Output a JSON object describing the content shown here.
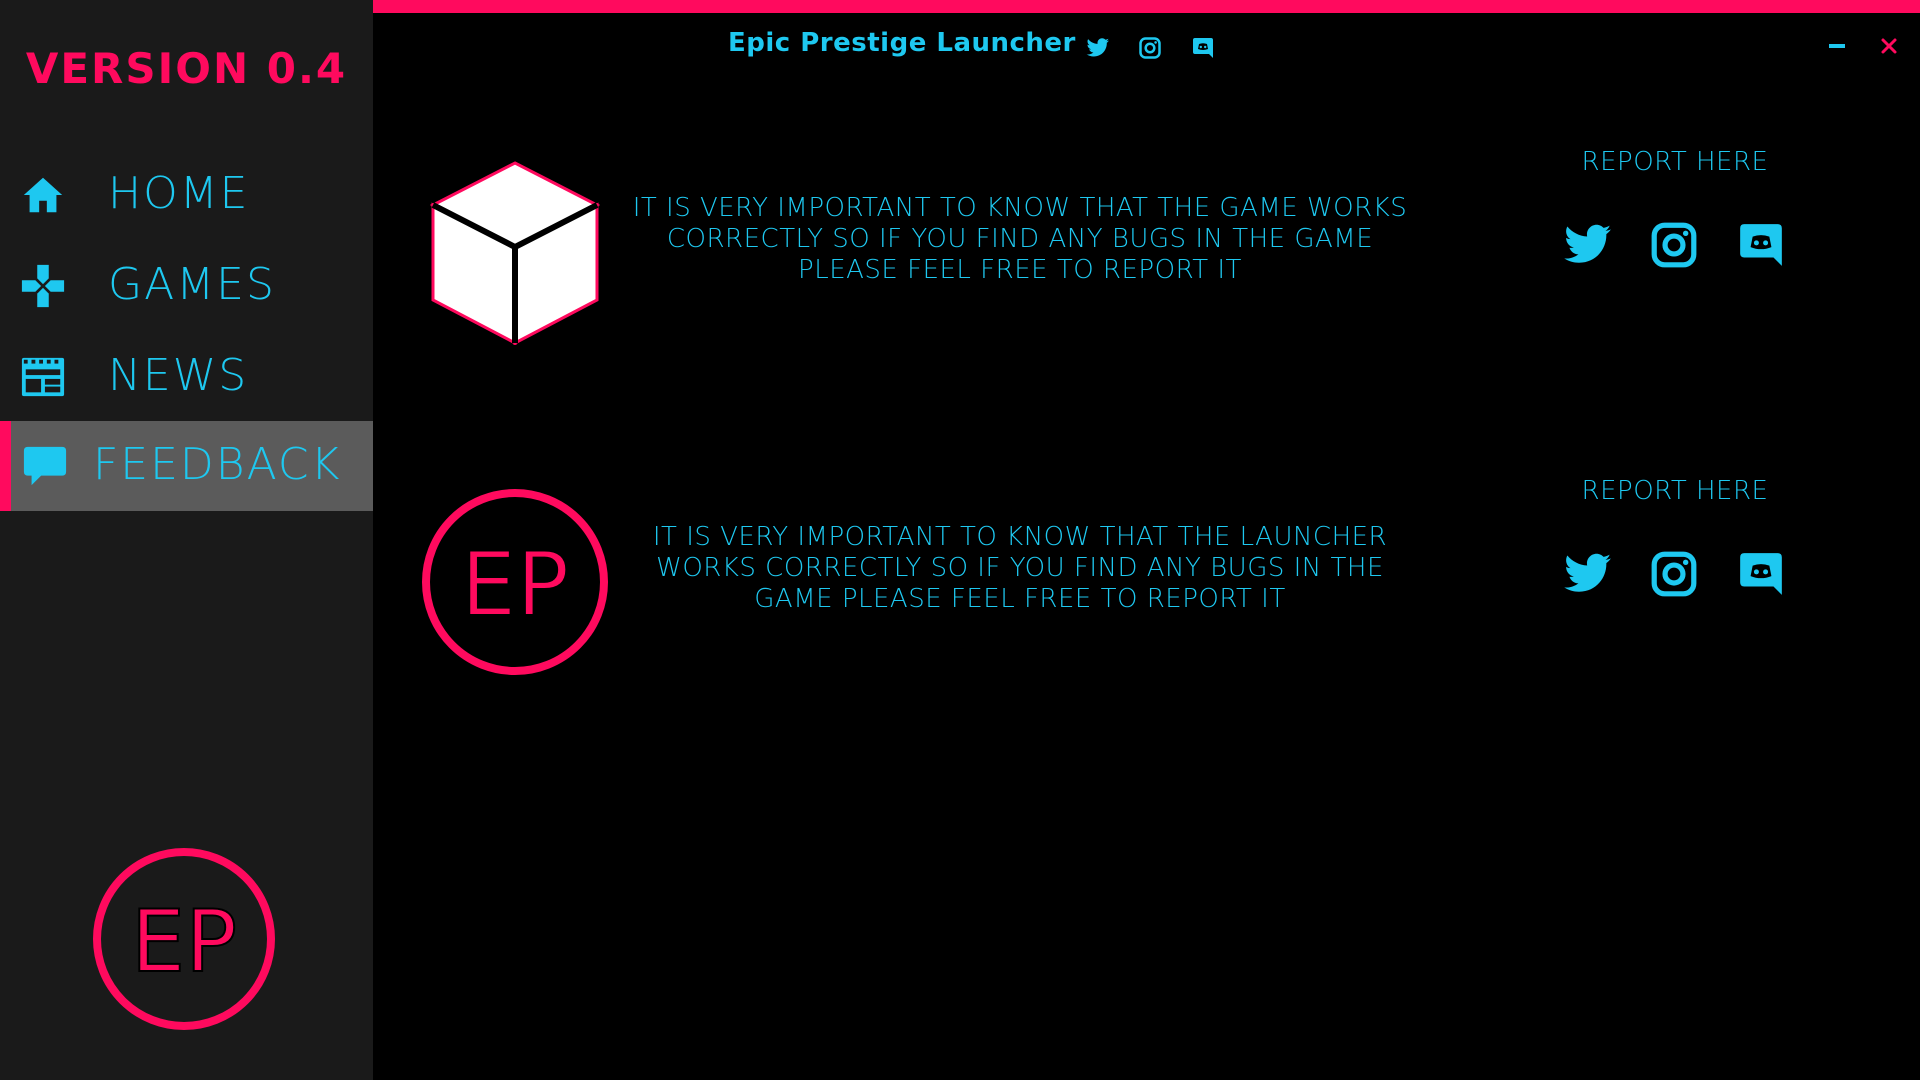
{
  "app": {
    "title": "Epic Prestige Launcher",
    "version_label": "VERSION 0.4",
    "logo_text": "EP"
  },
  "colors": {
    "accent": "#ff0a5e",
    "text": "#1ec8f0",
    "sidebar_bg": "#1a1a1a",
    "active_bg": "#5b5b5b",
    "main_bg": "#000000"
  },
  "title_bar": {
    "socials": [
      {
        "icon": "twitter-icon"
      },
      {
        "icon": "instagram-icon"
      },
      {
        "icon": "discord-icon"
      }
    ],
    "controls": [
      {
        "icon": "minimize-icon"
      },
      {
        "icon": "close-icon"
      }
    ]
  },
  "sidebar": {
    "items": [
      {
        "label": "HOME",
        "icon": "home-icon",
        "active": false
      },
      {
        "label": "GAMES",
        "icon": "gamepad-icon",
        "active": false
      },
      {
        "label": "NEWS",
        "icon": "newspaper-icon",
        "active": false
      },
      {
        "label": "FEEDBACK",
        "icon": "chat-bubble-icon",
        "active": true
      }
    ]
  },
  "feedback": {
    "sections": [
      {
        "icon": "cube-icon",
        "text": "IT IS VERY IMPORTANT TO KNOW THAT THE GAME WORKS CORRECTLY SO IF YOU FIND ANY BUGS IN THE GAME PLEASE FEEL FREE TO REPORT IT",
        "report_label": "REPORT HERE",
        "report_icons": [
          "twitter-icon",
          "instagram-icon",
          "discord-icon"
        ]
      },
      {
        "icon": "ep-logo",
        "text": "IT IS VERY IMPORTANT TO KNOW THAT THE LAUNCHER WORKS CORRECTLY SO IF YOU FIND ANY BUGS IN THE GAME PLEASE FEEL FREE TO REPORT IT",
        "report_label": "REPORT HERE",
        "report_icons": [
          "twitter-icon",
          "instagram-icon",
          "discord-icon"
        ]
      }
    ]
  }
}
